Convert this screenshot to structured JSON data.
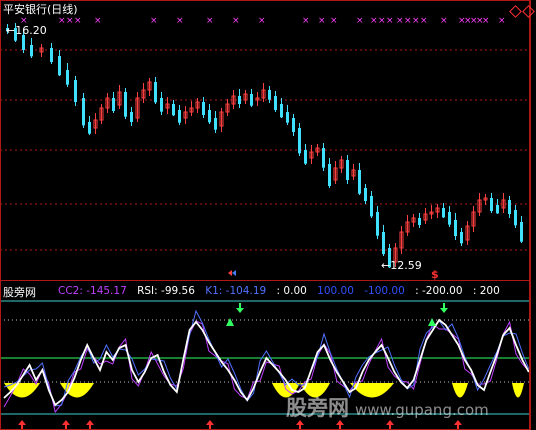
{
  "title": "平安银行(日线)",
  "price_high_label": "16.20",
  "price_low_label": "12.59",
  "site_label": "股旁网",
  "indicator": {
    "cc2": {
      "text": "CC2: -145.17",
      "color": "#c040ff"
    },
    "rsi": {
      "text": "RSI: -99.56",
      "color": "#ffffff"
    },
    "k1": {
      "text": "K1: -104.19",
      "color": "#5070ff"
    },
    "v1": {
      "text": ": 0.00",
      "color": "#ffffff"
    },
    "v2": {
      "text": "100.00",
      "color": "#3050ff"
    },
    "v3": {
      "text": "-100.00",
      "color": "#3050ff"
    },
    "v4": {
      "text": ": -200.00",
      "color": "#ffffff"
    },
    "v5": {
      "text": ": 200",
      "color": "#ffffff"
    }
  },
  "watermark": {
    "text": "股旁网",
    "url": "www.gupang.com"
  },
  "colors": {
    "background": "#000000",
    "frame": "#b01818",
    "up": "#ff4040",
    "down": "#40e0ff",
    "level_line_cyan": "#40d0d0",
    "level_line_green": "#30ff60",
    "fill_yellow": "#ffff00",
    "marker_magenta": "#ff40ff"
  }
}
